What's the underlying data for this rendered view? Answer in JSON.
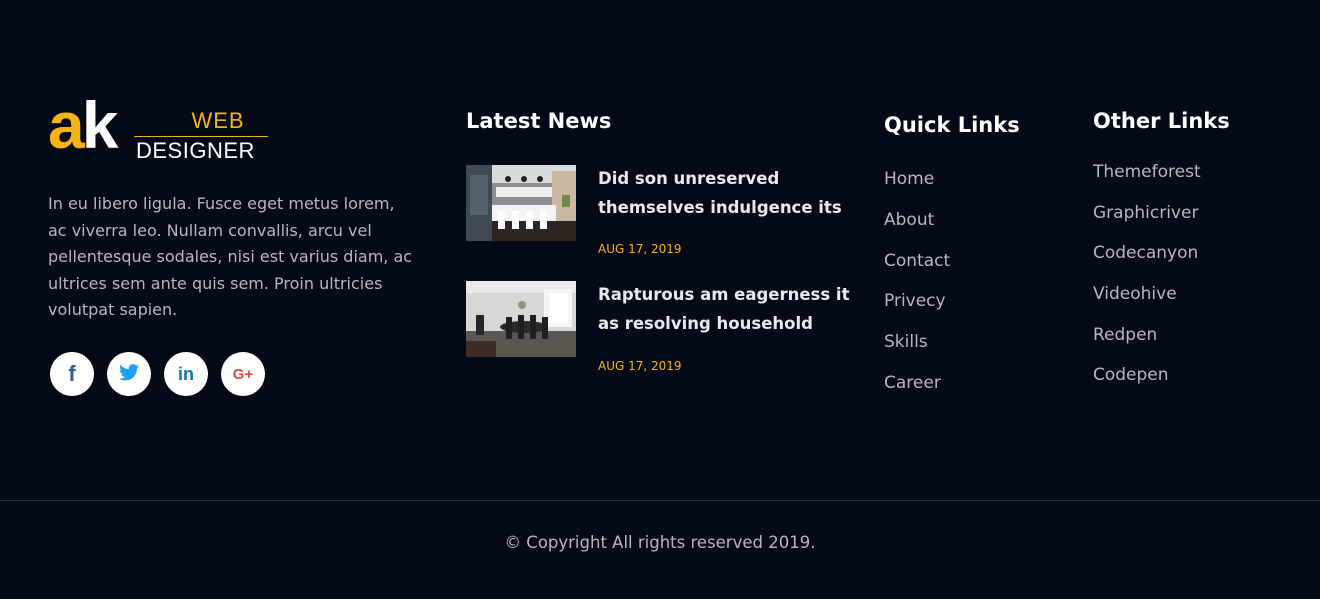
{
  "brand": {
    "mark_a": "a",
    "mark_k": "k",
    "top": "WEB",
    "bottom": "DESIGNER"
  },
  "about": {
    "text": "In eu libero ligula. Fusce eget metus lorem, ac viverra leo. Nullam convallis, arcu vel pellentesque sodales, nisi est varius diam, ac ultrices sem ante quis sem. Proin ultricies volutpat sapien."
  },
  "socials": [
    {
      "icon": "facebook-icon",
      "glyph": "f",
      "color": "#3b5998"
    },
    {
      "icon": "twitter-icon",
      "glyph": "t",
      "color": "#1da1f2"
    },
    {
      "icon": "linkedin-icon",
      "glyph": "in",
      "color": "#0e76a8"
    },
    {
      "icon": "google-plus-icon",
      "glyph": "G+",
      "color": "#dd4b39"
    }
  ],
  "news": {
    "heading": "Latest News",
    "items": [
      {
        "title": "Did son unreserved themselves indulgence its",
        "date": "AUG 17, 2019"
      },
      {
        "title": "Rapturous am eagerness it as resolving household",
        "date": "AUG 17, 2019"
      }
    ]
  },
  "quick_links": {
    "heading": "Quick Links",
    "items": [
      "Home",
      "About",
      "Contact",
      "Privecy",
      "Skills",
      "Career"
    ]
  },
  "other_links": {
    "heading": "Other Links",
    "items": [
      "Themeforest",
      "Graphicriver",
      "Codecanyon",
      "Videohive",
      "Redpen",
      "Codepen"
    ]
  },
  "copyright": "© Copyright All rights reserved 2019.",
  "colors": {
    "background": "#050a17",
    "accent": "#f5b316",
    "text": "#b5b8c0",
    "heading": "#ffffff"
  }
}
